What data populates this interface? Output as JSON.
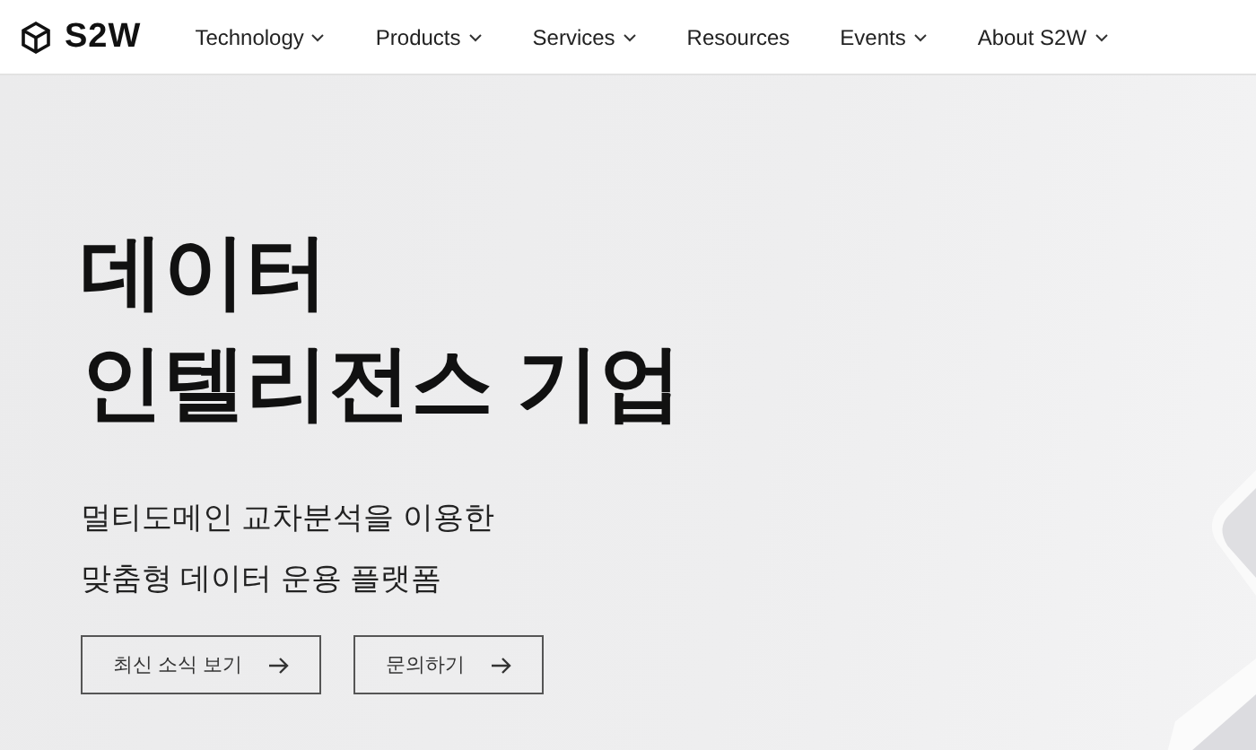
{
  "header": {
    "logo": "S2W",
    "nav": [
      {
        "label": "Technology",
        "dropdown": true
      },
      {
        "label": "Products",
        "dropdown": true
      },
      {
        "label": "Services",
        "dropdown": true
      },
      {
        "label": "Resources",
        "dropdown": false
      },
      {
        "label": "Events",
        "dropdown": true
      },
      {
        "label": "About S2W",
        "dropdown": true
      }
    ]
  },
  "hero": {
    "title_lines": [
      "데이터",
      "인텔리전스 기업"
    ],
    "subtitle_lines": [
      "멀티도메인 교차분석을 이용한",
      "맞춤형 데이터 운용 플랫폼"
    ],
    "buttons": [
      {
        "label": "최신 소식 보기"
      },
      {
        "label": "문의하기"
      }
    ]
  }
}
